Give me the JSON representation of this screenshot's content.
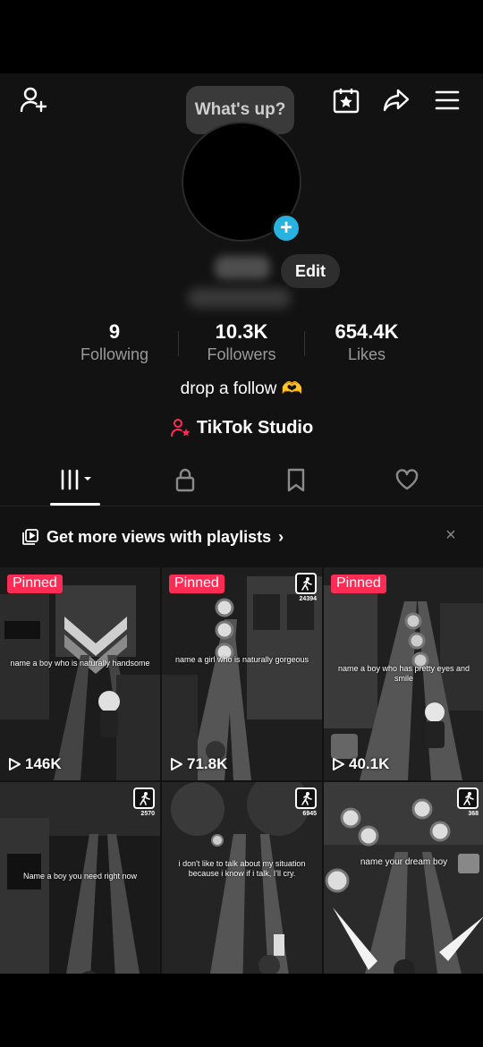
{
  "header": {
    "add_friend_icon": "person-plus-icon",
    "calendar_icon": "star-calendar-icon",
    "share_icon": "share-arrow-icon",
    "menu_icon": "hamburger-menu-icon"
  },
  "profile": {
    "status_bubble": "What's up?",
    "edit_label": "Edit"
  },
  "stats": [
    {
      "value": "9",
      "label": "Following"
    },
    {
      "value": "10.3K",
      "label": "Followers"
    },
    {
      "value": "654.4K",
      "label": "Likes"
    }
  ],
  "bio": "drop a follow 🫶",
  "studio": {
    "label": "TikTok Studio"
  },
  "tabs": [
    "videos",
    "private",
    "saved",
    "liked"
  ],
  "playlist_banner": {
    "text": "Get more views with playlists",
    "chevron": "›",
    "close": "×"
  },
  "videos": [
    {
      "pinned": "Pinned",
      "caption": "name a boy who is naturally handsome",
      "views": "146K"
    },
    {
      "pinned": "Pinned",
      "caption": "name a girl who is naturally gorgeous",
      "views": "71.8K",
      "score": "24394"
    },
    {
      "pinned": "Pinned",
      "caption": "name a boy who has pretty eyes and smile",
      "views": "40.1K"
    },
    {
      "caption": "Name a boy you need right now",
      "score": "2570"
    },
    {
      "caption": "i don't like to talk about my situation because i know if i talk, I'll cry.",
      "score": "6945"
    },
    {
      "caption": "name your dream boy",
      "score": "368"
    }
  ],
  "colors": {
    "accent_pink": "#fe2c55",
    "avatar_plus": "#28b2e0",
    "background": "#121212"
  }
}
